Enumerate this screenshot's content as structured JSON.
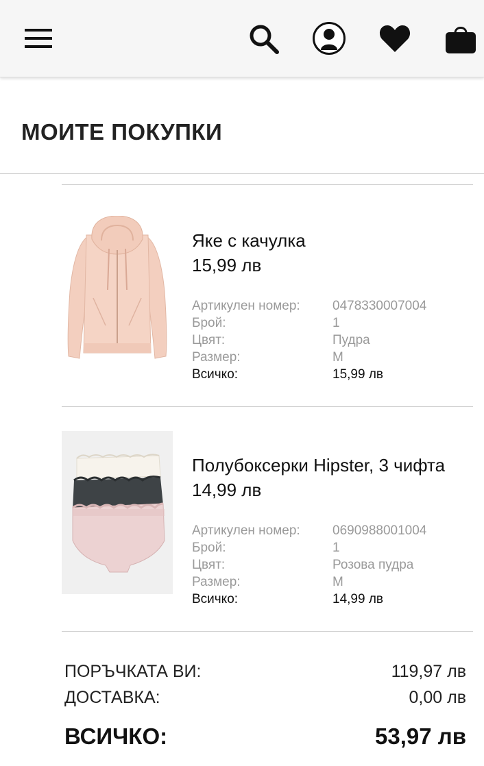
{
  "header": {
    "icons": [
      "menu-icon",
      "search-icon",
      "account-icon",
      "heart-icon",
      "shopping-bag-icon"
    ]
  },
  "page": {
    "title": "МОИТЕ ПОКУПКИ"
  },
  "labels": {
    "article_number": "Артикулен номер:",
    "quantity": "Брой:",
    "color": "Цвят:",
    "size": "Размер:",
    "total": "Всичко:"
  },
  "items": [
    {
      "name": "Яке с качулка",
      "price": "15,99 лв",
      "article_number": "0478330007004",
      "quantity": "1",
      "color": "Пудра",
      "size": "M",
      "total": "15,99 лв",
      "image_color": "#f3cfbf"
    },
    {
      "name": "Полубоксерки Hipster, 3 чифта",
      "price": "14,99 лв",
      "article_number": "0690988001004",
      "quantity": "1",
      "color": "Розова пудра",
      "size": "M",
      "total": "14,99 лв",
      "image_color": "#f0f0f0"
    }
  ],
  "summary": {
    "order_label": "ПОРЪЧКАТА ВИ:",
    "order_value": "119,97 лв",
    "delivery_label": "ДОСТАВКА:",
    "delivery_value": "0,00 лв",
    "total_label": "ВСИЧКО:",
    "total_value": "53,97 лв"
  }
}
